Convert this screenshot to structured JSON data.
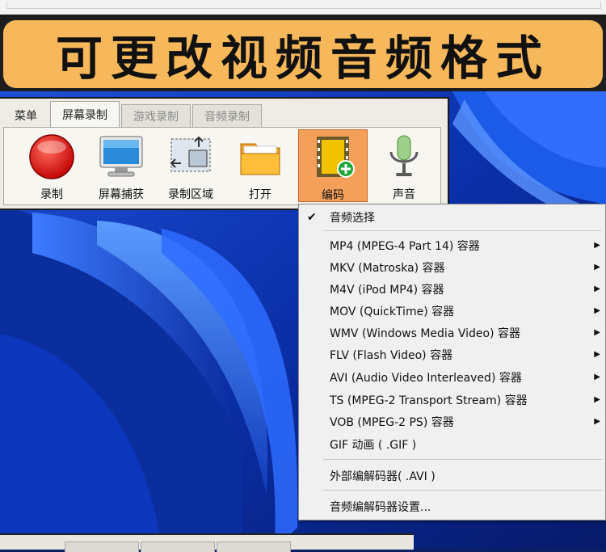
{
  "banner": {
    "title": "可更改视频音频格式"
  },
  "app": {
    "tabs": [
      {
        "label": "菜单"
      },
      {
        "label": "屏幕录制"
      },
      {
        "label": "游戏录制"
      },
      {
        "label": "音频录制"
      }
    ],
    "toolbar": [
      {
        "label": "录制",
        "icon": "record-icon"
      },
      {
        "label": "屏幕捕获",
        "icon": "monitor-icon"
      },
      {
        "label": "录制区域",
        "icon": "region-icon"
      },
      {
        "label": "打开",
        "icon": "folder-icon"
      },
      {
        "label": "编码",
        "icon": "encode-icon"
      },
      {
        "label": "声音",
        "icon": "microphone-icon"
      }
    ]
  },
  "menu": {
    "items": [
      {
        "label": "音频选择",
        "checked": true
      },
      {
        "label": "MP4 (MPEG-4 Part 14) 容器"
      },
      {
        "label": "MKV (Matroska) 容器"
      },
      {
        "label": "M4V (iPod MP4) 容器"
      },
      {
        "label": "MOV (QuickTime) 容器"
      },
      {
        "label": "WMV (Windows Media Video) 容器"
      },
      {
        "label": "FLV (Flash Video) 容器"
      },
      {
        "label": "AVI (Audio Video Interleaved) 容器"
      },
      {
        "label": "TS (MPEG-2 Transport Stream) 容器"
      },
      {
        "label": "VOB (MPEG-2 PS) 容器"
      },
      {
        "label": "GIF 动画 ( .GIF )"
      },
      {
        "label": "外部编解码器( .AVI )"
      },
      {
        "label": "音频编解码器设置..."
      }
    ],
    "submenu_arrow": "▶",
    "check_glyph": "✔"
  },
  "colors": {
    "banner": "#f6b85a",
    "selected_tool": "#f5a05a",
    "desktop": "#0a2a8a"
  }
}
